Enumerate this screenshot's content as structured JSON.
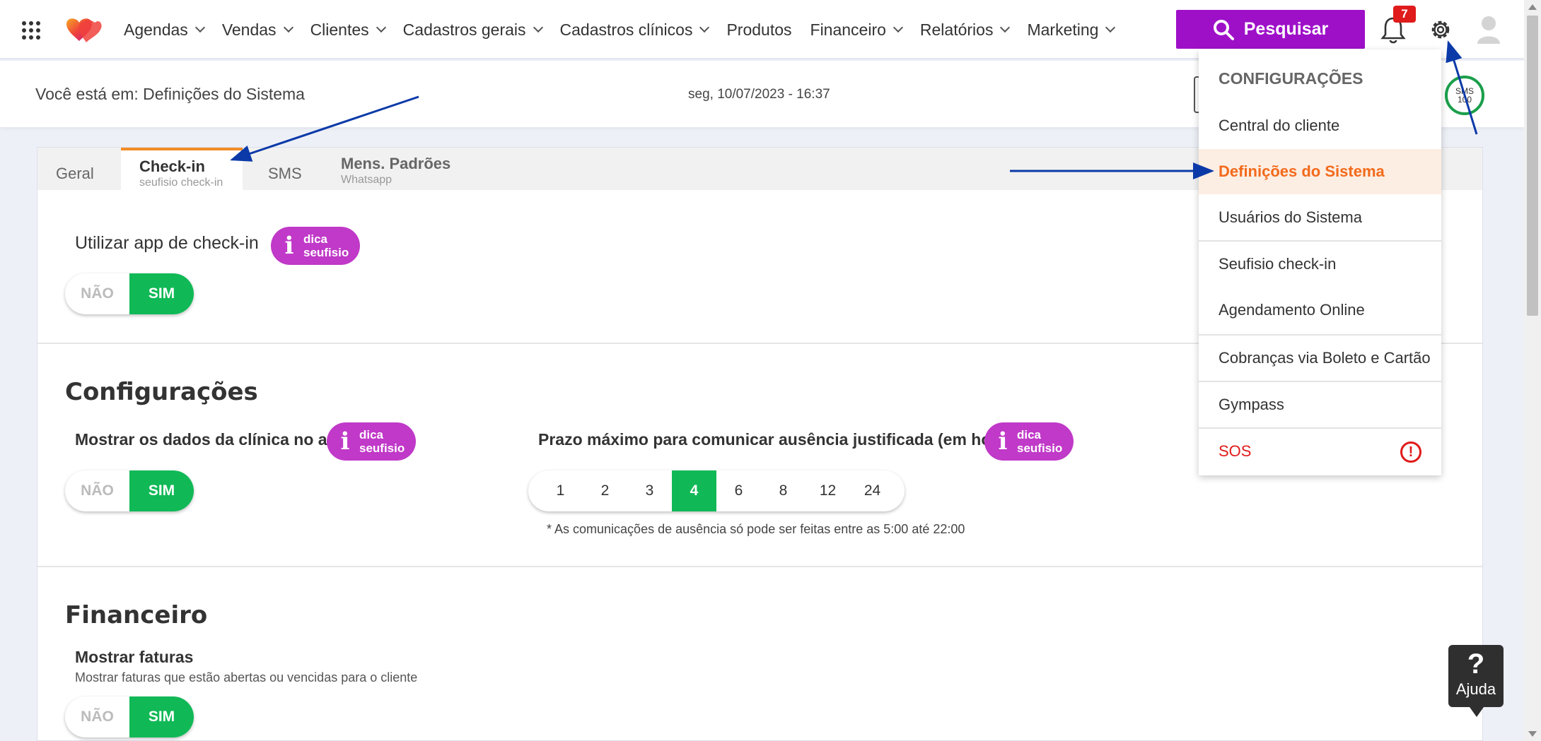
{
  "nav": {
    "items": [
      {
        "label": "Agendas",
        "dropdown": true
      },
      {
        "label": "Vendas",
        "dropdown": true
      },
      {
        "label": "Clientes",
        "dropdown": true
      },
      {
        "label": "Cadastros gerais",
        "dropdown": true
      },
      {
        "label": "Cadastros clínicos",
        "dropdown": true
      },
      {
        "label": "Produtos",
        "dropdown": false
      },
      {
        "label": "Financeiro",
        "dropdown": true
      },
      {
        "label": "Relatórios",
        "dropdown": true
      },
      {
        "label": "Marketing",
        "dropdown": true
      }
    ],
    "search_label": "Pesquisar",
    "notification_count": "7"
  },
  "header": {
    "breadcrumb": "Você está em: Definições do Sistema",
    "datetime": "seg, 10/07/2023 - 16:37",
    "sms_badge_line1": "SMS",
    "sms_badge_line2": "100"
  },
  "tabs": {
    "geral": "Geral",
    "checkin": "Check-in",
    "checkin_sub": "seufisio check-in",
    "sms": "SMS",
    "mens": "Mens. Padrões",
    "mens_sub": "Whatsapp"
  },
  "dica": {
    "line1": "dica",
    "line2": "seufisio"
  },
  "toggle": {
    "off": "NÃO",
    "on": "SIM"
  },
  "checkin": {
    "use_app_label": "Utilizar app de check-in"
  },
  "config": {
    "title": "Configurações",
    "show_clinic_label": "Mostrar os dados da clínica no app",
    "deadline_label": "Prazo máximo para comunicar ausência justificada (em horas)",
    "hours": [
      "1",
      "2",
      "3",
      "4",
      "6",
      "8",
      "12",
      "24"
    ],
    "selected_hour": "4",
    "note": "* As comunicações de ausência só pode ser feitas entre as 5:00 até 22:00"
  },
  "financeiro": {
    "title": "Financeiro",
    "show_invoices_label": "Mostrar faturas",
    "show_invoices_desc": "Mostrar faturas que estão abertas ou vencidas para o cliente"
  },
  "dropdown": {
    "title": "CONFIGURAÇÕES",
    "items": [
      "Central do cliente",
      "Definições do Sistema",
      "Usuários do Sistema",
      "Seufisio check-in",
      "Agendamento Online",
      "Cobranças via Boleto e Cartão",
      "Gympass",
      "SOS"
    ],
    "active_item": "Definições do Sistema"
  },
  "help": {
    "label": "Ajuda"
  },
  "colors": {
    "brand_purple": "#9e10c8",
    "dica_magenta": "#c039c8",
    "toggle_green": "#10b956",
    "active_orange": "#f26a1b",
    "annotation_arrow": "#0b3aa8"
  }
}
